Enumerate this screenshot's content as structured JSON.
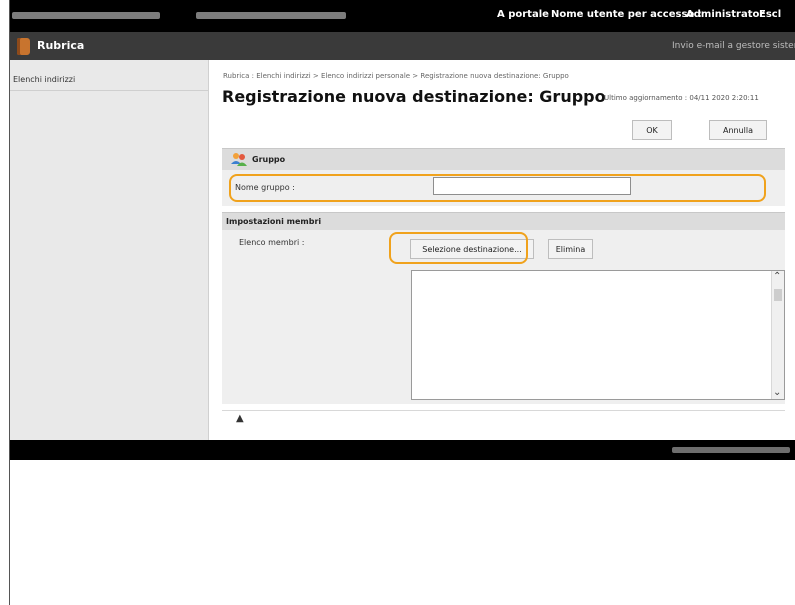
{
  "topbar": {
    "portal_link": "A portale",
    "user_label": "Nome utente per accesso :",
    "user_name": "Administrator",
    "logout_link": "Escl"
  },
  "app": {
    "title": "Rubrica",
    "mail_admin": "Invio e-mail a gestore sistema"
  },
  "sidebar": {
    "items": [
      {
        "label": "Elenchi indirizzi"
      }
    ]
  },
  "main": {
    "breadcrumb": "Rubrica : Elenchi indirizzi > Elenco indirizzi personale > Registrazione nuova destinazione: Gruppo",
    "page_title": "Registrazione nuova destinazione: Gruppo",
    "last_update": "Ultimo aggiornamento : 04/11 2020 2:20:11",
    "ok_label": "OK",
    "cancel_label": "Annulla",
    "group_section": {
      "title": "Gruppo",
      "name_label": "Nome gruppo :",
      "name_value": ""
    },
    "members_section": {
      "title": "Impostazioni membri",
      "list_label": "Elenco membri :",
      "select_button": "Selezione destinazione...",
      "delete_button": "Elimina",
      "members": []
    },
    "back_to_top": "▲"
  },
  "colors": {
    "highlight": "#f0a21c",
    "topbar": "#000000",
    "appbar": "#3a3a3a"
  }
}
